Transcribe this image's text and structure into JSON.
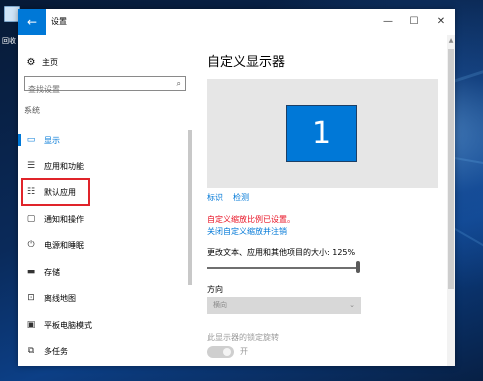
{
  "desktop": {
    "icon_label": "回收"
  },
  "window": {
    "title": "设置",
    "back_glyph": "←",
    "minimize_glyph": "—",
    "maximize_glyph": "☐",
    "close_glyph": "✕"
  },
  "sidebar": {
    "home_label": "主页",
    "search_placeholder": "查找设置",
    "section_label": "系统",
    "items": [
      {
        "label": "显示",
        "icon": "display-icon",
        "glyph": "▭"
      },
      {
        "label": "应用和功能",
        "icon": "apps-list-icon",
        "glyph": "☰"
      },
      {
        "label": "默认应用",
        "icon": "default-apps-icon",
        "glyph": "☷"
      },
      {
        "label": "通知和操作",
        "icon": "notification-icon",
        "glyph": "▢"
      },
      {
        "label": "电源和睡眠",
        "icon": "power-icon",
        "glyph": "⏻"
      },
      {
        "label": "存储",
        "icon": "storage-icon",
        "glyph": "▬"
      },
      {
        "label": "离线地图",
        "icon": "map-icon",
        "glyph": "⊡"
      },
      {
        "label": "平板电脑模式",
        "icon": "tablet-icon",
        "glyph": "▣"
      },
      {
        "label": "多任务",
        "icon": "multitask-icon",
        "glyph": "⧉"
      }
    ]
  },
  "main": {
    "title": "自定义显示器",
    "monitor_number": "1",
    "link_identify": "标识",
    "link_detect": "检测",
    "warning": "自定义缩放比例已设置。",
    "warning_link": "关闭自定义缩放并注销",
    "scale_label": "更改文本、应用和其他项目的大小: 125%",
    "scale_fraction": 1.0,
    "orientation_label": "方向",
    "orientation_value": "横向",
    "lock_rotation_label": "此显示器的锁定旋转",
    "toggle_state": "开"
  },
  "colors": {
    "accent": "#0078d7",
    "warning": "#e81123",
    "highlight_box": "#e0242a"
  }
}
